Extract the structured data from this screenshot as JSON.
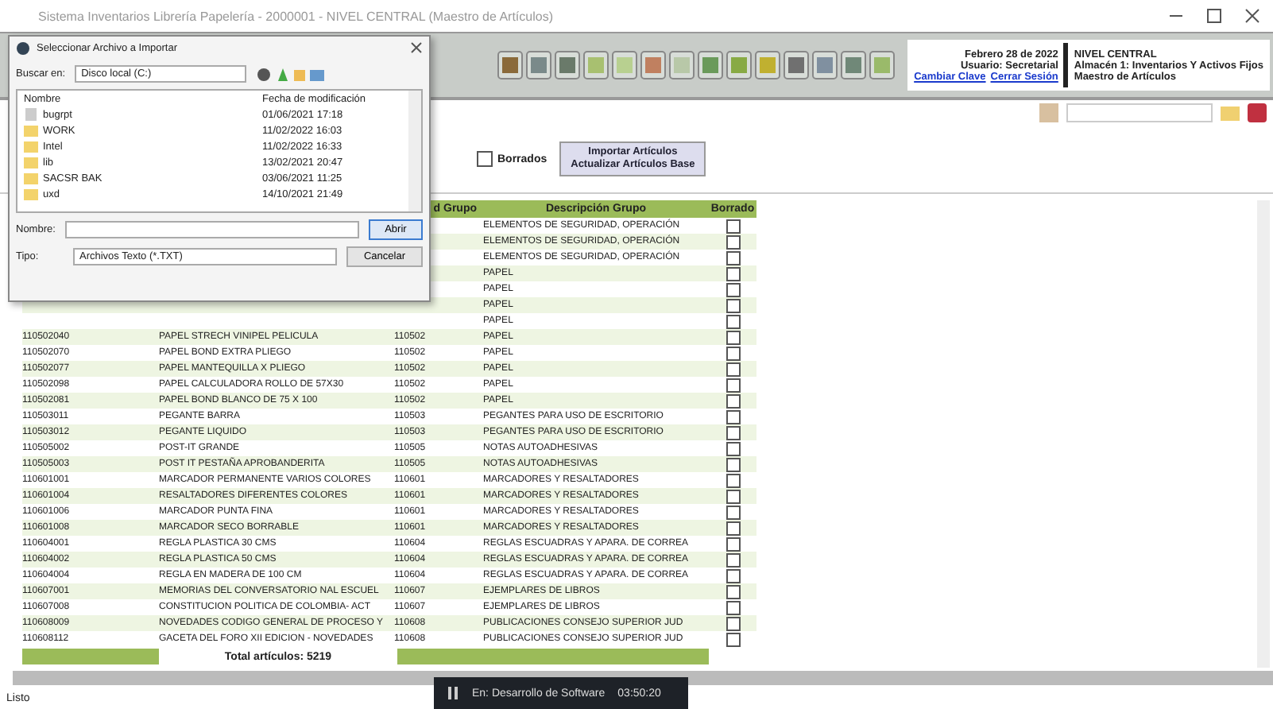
{
  "window": {
    "title": "Sistema Inventarios Librería Papelería - 2000001 - NIVEL CENTRAL (Maestro de Artículos)"
  },
  "header": {
    "date": "Febrero 28 de 2022",
    "level": "NIVEL CENTRAL",
    "user": "Usuario: Secretarial",
    "store": "Almacén 1: Inventarios Y Activos Fijos",
    "links": [
      "Cambiar Clave",
      "Cerrar Sesión"
    ],
    "module": "Maestro de Artículos"
  },
  "filters": {
    "deleted": {
      "label": "Borrados",
      "checked": false
    },
    "import_button": [
      "Importar Artículos",
      "Actualizar Artículos Base"
    ]
  },
  "table": {
    "columns": [
      "",
      "",
      "d Grupo",
      "Descripción Grupo",
      "Borrado"
    ],
    "rows": [
      {
        "group_description": "ELEMENTOS DE SEGURIDAD, OPERACIÓN",
        "deleted": false
      },
      {
        "group_description": "ELEMENTOS DE SEGURIDAD, OPERACIÓN",
        "deleted": false
      },
      {
        "group_description": "ELEMENTOS DE SEGURIDAD, OPERACIÓN",
        "deleted": false
      },
      {
        "group_description": "PAPEL",
        "deleted": false
      },
      {
        "group_description": "PAPEL",
        "deleted": false
      },
      {
        "group_description": "PAPEL",
        "deleted": false
      },
      {
        "group_description": "PAPEL",
        "deleted": false
      },
      {
        "code": "110502040",
        "description": "PAPEL STRECH VINIPEL PELICULA",
        "group_code": "110502",
        "group_description": "PAPEL",
        "deleted": false
      },
      {
        "code": "110502070",
        "description": "PAPEL BOND EXTRA PLIEGO",
        "group_code": "110502",
        "group_description": "PAPEL",
        "deleted": false
      },
      {
        "code": "110502077",
        "description": "PAPEL MANTEQUILLA X PLIEGO",
        "group_code": "110502",
        "group_description": "PAPEL",
        "deleted": false
      },
      {
        "code": "110502098",
        "description": "PAPEL CALCULADORA ROLLO DE 57X30",
        "group_code": "110502",
        "group_description": "PAPEL",
        "deleted": false
      },
      {
        "code": "110502081",
        "description": "PAPEL BOND BLANCO DE 75 X 100",
        "group_code": "110502",
        "group_description": "PAPEL",
        "deleted": false
      },
      {
        "code": "110503011",
        "description": "PEGANTE BARRA",
        "group_code": "110503",
        "group_description": "PEGANTES PARA USO DE ESCRITORIO",
        "deleted": false
      },
      {
        "code": "110503012",
        "description": "PEGANTE LIQUIDO",
        "group_code": "110503",
        "group_description": "PEGANTES PARA USO DE ESCRITORIO",
        "deleted": false
      },
      {
        "code": "110505002",
        "description": "POST-IT GRANDE",
        "group_code": "110505",
        "group_description": "NOTAS AUTOADHESIVAS",
        "deleted": false
      },
      {
        "code": "110505003",
        "description": "POST IT PESTAÑA APROBANDERITA",
        "group_code": "110505",
        "group_description": "NOTAS AUTOADHESIVAS",
        "deleted": false
      },
      {
        "code": "110601001",
        "description": "MARCADOR PERMANENTE VARIOS COLORES",
        "group_code": "110601",
        "group_description": "MARCADORES Y RESALTADORES",
        "deleted": false
      },
      {
        "code": "110601004",
        "description": "RESALTADORES DIFERENTES COLORES",
        "group_code": "110601",
        "group_description": "MARCADORES Y RESALTADORES",
        "deleted": false
      },
      {
        "code": "110601006",
        "description": "MARCADOR PUNTA FINA",
        "group_code": "110601",
        "group_description": "MARCADORES Y RESALTADORES",
        "deleted": false
      },
      {
        "code": "110601008",
        "description": "MARCADOR SECO BORRABLE",
        "group_code": "110601",
        "group_description": "MARCADORES Y RESALTADORES",
        "deleted": false
      },
      {
        "code": "110604001",
        "description": "REGLA PLASTICA 30 CMS",
        "group_code": "110604",
        "group_description": "REGLAS ESCUADRAS Y APARA. DE CORREA",
        "deleted": false
      },
      {
        "code": "110604002",
        "description": "REGLA PLASTICA 50 CMS",
        "group_code": "110604",
        "group_description": "REGLAS ESCUADRAS Y APARA. DE CORREA",
        "deleted": false
      },
      {
        "code": "110604004",
        "description": "REGLA EN MADERA DE 100 CM",
        "group_code": "110604",
        "group_description": "REGLAS ESCUADRAS Y APARA. DE CORREA",
        "deleted": false
      },
      {
        "code": "110607001",
        "description": "MEMORIAS DEL CONVERSATORIO NAL ESCUEL",
        "group_code": "110607",
        "group_description": "EJEMPLARES DE LIBROS",
        "deleted": false
      },
      {
        "code": "110607008",
        "description": "CONSTITUCION POLITICA DE COLOMBIA- ACT",
        "group_code": "110607",
        "group_description": "EJEMPLARES DE LIBROS",
        "deleted": false
      },
      {
        "code": "110608009",
        "description": "NOVEDADES CODIGO GENERAL DE PROCESO Y",
        "group_code": "110608",
        "group_description": "PUBLICACIONES CONSEJO SUPERIOR JUD",
        "deleted": false
      },
      {
        "code": "110608112",
        "description": "GACETA DEL FORO XII EDICION - NOVEDADES",
        "group_code": "110608",
        "group_description": "PUBLICACIONES CONSEJO SUPERIOR JUD",
        "deleted": false
      }
    ],
    "total": "Total artículos: 5219"
  },
  "dialog": {
    "title": "Seleccionar Archivo a Importar",
    "look_in_label": "Buscar en:",
    "look_in": "Disco local (C:)",
    "columns": [
      "Nombre",
      "Fecha de modificación"
    ],
    "items": [
      {
        "name": "bugrpt",
        "date": "01/06/2021 17:18",
        "kind": "file"
      },
      {
        "name": "WORK",
        "date": "11/02/2022 16:03",
        "kind": "folder"
      },
      {
        "name": "Intel",
        "date": "11/02/2022 16:33",
        "kind": "folder"
      },
      {
        "name": "lib",
        "date": "13/02/2021 20:47",
        "kind": "folder"
      },
      {
        "name": "SACSR BAK",
        "date": "03/06/2021 11:25",
        "kind": "folder"
      },
      {
        "name": "uxd",
        "date": "14/10/2021 21:49",
        "kind": "folder"
      }
    ],
    "name_label": "Nombre:",
    "type_label": "Tipo:",
    "type": "Archivos Texto (*.TXT)",
    "buttons": [
      "Abrir",
      "Cancelar"
    ]
  },
  "status_bar": {
    "text": "Listo"
  },
  "recorder": {
    "label": "En: Desarrollo de Software",
    "time": "03:50:20"
  }
}
